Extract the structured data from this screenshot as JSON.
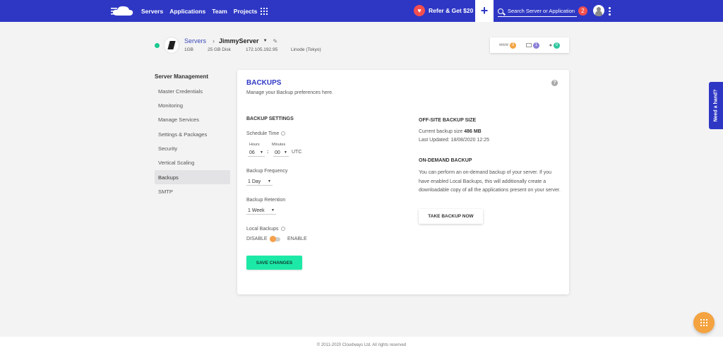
{
  "topbar": {
    "nav": [
      "Servers",
      "Applications",
      "Team",
      "Projects"
    ],
    "refer_label": "Refer & Get $20",
    "search_placeholder": "Search Server or Application",
    "notification_count": "2"
  },
  "server": {
    "breadcrumb_root": "Servers",
    "name": "JimmyServer",
    "ram": "1GB",
    "disk": "25 GB Disk",
    "ip": "172.105.192.95",
    "provider": "Linode (Tokyo)",
    "stats": [
      {
        "label": "www",
        "count": "3",
        "color": "#f4a340"
      },
      {
        "label": "",
        "count": "1",
        "color": "#8a7fd6"
      },
      {
        "label": "",
        "count": "0",
        "color": "#2fc7a0"
      }
    ]
  },
  "sidebar": {
    "title": "Server Management",
    "items": [
      {
        "label": "Master Credentials"
      },
      {
        "label": "Monitoring"
      },
      {
        "label": "Manage Services"
      },
      {
        "label": "Settings & Packages"
      },
      {
        "label": "Security"
      },
      {
        "label": "Vertical Scaling"
      },
      {
        "label": "Backups"
      },
      {
        "label": "SMTP"
      }
    ],
    "active_index": 6
  },
  "card": {
    "title": "BACKUPS",
    "subtitle": "Manage your Backup preferences here.",
    "settings_heading": "BACKUP SETTINGS",
    "schedule_label": "Schedule Time",
    "hours_label": "Hours",
    "minutes_label": "Minutes",
    "hours_value": "06",
    "minutes_value": "00",
    "time_sep": ":",
    "timezone": "UTC",
    "frequency_label": "Backup Frequency",
    "frequency_value": "1 Day",
    "retention_label": "Backup Retention",
    "retention_value": "1 Week",
    "local_label": "Local Backups",
    "disable_label": "DISABLE",
    "enable_label": "ENABLE",
    "save_label": "SAVE CHANGES",
    "offsite_heading": "OFF-SITE BACKUP SIZE",
    "current_size_label": "Current backup size",
    "current_size_value": "486 MB",
    "last_updated": "Last Updated: 18/08/2020 12:25",
    "ondemand_heading": "ON-DEMAND BACKUP",
    "ondemand_text": "You can perform an on-demand backup of your server. If you have enabled Local Backups, this will additionally create a downloadable copy of all the applications present on your server.",
    "take_backup_label": "TAKE BACKUP NOW"
  },
  "help_tab": "Need a hand?",
  "footer": "© 2011-2020 Cloudways Ltd. All rights reserved"
}
